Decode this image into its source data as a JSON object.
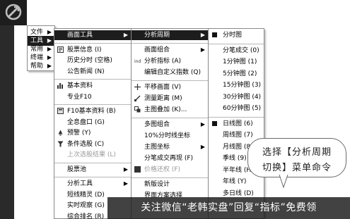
{
  "menu_level1": [
    {
      "label": "文件",
      "has_submenu": true
    },
    {
      "label": "工具",
      "has_submenu": true,
      "highlighted": true
    },
    {
      "label": "常用",
      "has_submenu": true
    },
    {
      "label": "终端",
      "has_submenu": true
    },
    {
      "label": "帮助",
      "has_submenu": true
    }
  ],
  "menu_level2": [
    {
      "label": "画面工具",
      "has_submenu": true,
      "highlighted": true
    },
    {
      "label": "股票信息 (I)",
      "icon": "info-icon"
    },
    {
      "label": "历史分时 (空格)"
    },
    {
      "label": "公告新闻 (N)"
    },
    {
      "label": "基本资料",
      "icon": "stock-data-icon"
    },
    {
      "label": "专业F10"
    },
    {
      "label": "F10基本资料 (B)",
      "icon": "f10-icon"
    },
    {
      "label": "全息盘口 (G)"
    },
    {
      "label": "预警 (Y)",
      "icon": "bell-icon"
    },
    {
      "label": "条件选股 (C)",
      "icon": "filter-icon"
    },
    {
      "label": "上次选股结果 (L)",
      "dimmed": true
    },
    {
      "label": "股票池",
      "has_submenu": true
    },
    {
      "label": "分析工具",
      "has_submenu": true
    },
    {
      "label": "短线精灵 (D)"
    },
    {
      "label": "实时观察 (G)"
    },
    {
      "label": "综合排名 (R)"
    }
  ],
  "menu_level3": [
    {
      "label": "分析周期",
      "has_submenu": true,
      "highlighted": true
    },
    {
      "label": "画面组合",
      "has_submenu": true
    },
    {
      "label": "分析指标 (A)",
      "icon": "indicator-icon"
    },
    {
      "label": "编辑自定义指数 (Q)"
    },
    {
      "label": "平移画面 (V)",
      "icon": "move-icon"
    },
    {
      "label": "测量距离 (M)",
      "icon": "measure-icon"
    },
    {
      "label": "主图叠加 (K)...",
      "icon": "overlay-icon"
    },
    {
      "label": "多图组合",
      "has_submenu": true
    },
    {
      "label": "10%分时线坐标"
    },
    {
      "label": "主图坐标",
      "has_submenu": true
    },
    {
      "label": "分笔成交再现 (F)"
    },
    {
      "label": "价格还权 (F)",
      "icon": "price-icon",
      "dimmed": true
    },
    {
      "label": "新版设计"
    },
    {
      "label": "界面方案选择"
    }
  ],
  "menu_level4": [
    {
      "label": "分时图",
      "checked": true
    },
    {
      "label": "分笔成交 (0)"
    },
    {
      "label": "1分钟图 (1)"
    },
    {
      "label": "5分钟图 (2)"
    },
    {
      "label": "15分钟图 (3)"
    },
    {
      "label": "30分钟图 (4)"
    },
    {
      "label": "60分钟图 (5)"
    },
    {
      "label": "日线图 (6)",
      "checked": true
    },
    {
      "label": "周线图 (7)"
    },
    {
      "label": "月线图 (8)"
    },
    {
      "label": "季线 (9)"
    },
    {
      "label": "半年线 (H)"
    },
    {
      "label": "年线 (Y)"
    },
    {
      "label": "多日线 (D)"
    }
  ],
  "callout": {
    "line1": "选择【分析周期",
    "line2": "切换】菜单命令"
  },
  "banner": {
    "text": "关注微信“老韩实盘”回复“指标”免费领"
  }
}
